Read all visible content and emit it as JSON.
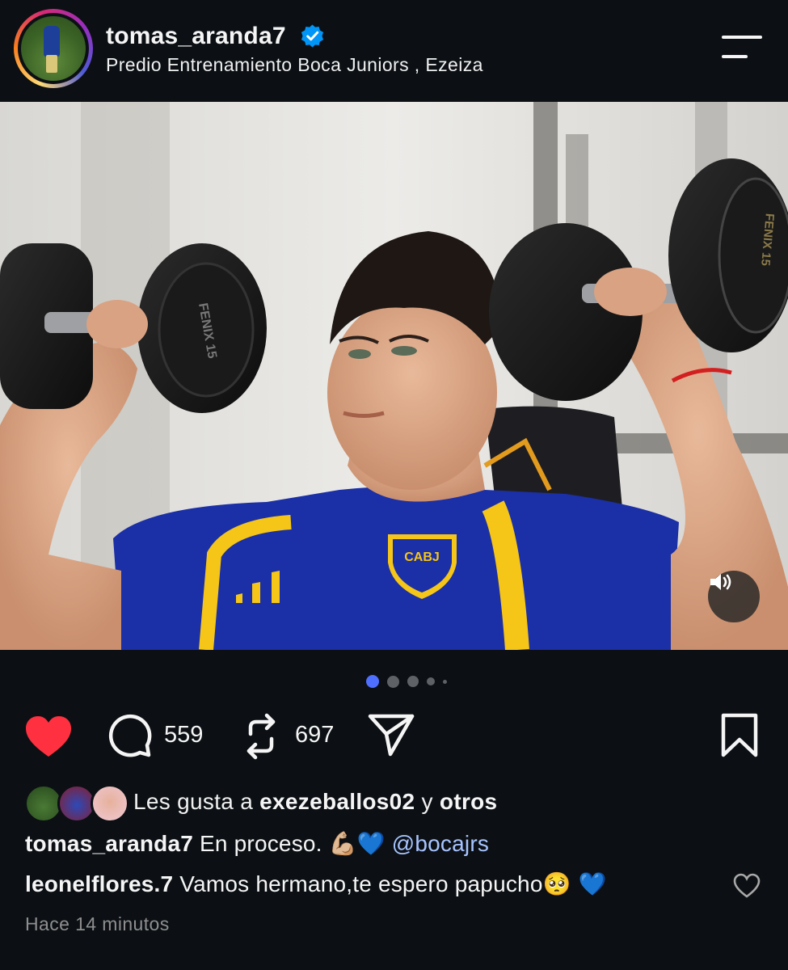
{
  "header": {
    "username": "tomas_aranda7",
    "location": "Predio Entrenamiento Boca Juniors , Ezeiza",
    "verified_icon": "verified-badge-icon",
    "menu_icon": "hamburger-menu-icon"
  },
  "post": {
    "jersey_text": "CABJ",
    "dumbbell_text": "FENIX 15",
    "carousel": {
      "total": 5,
      "active": 1
    }
  },
  "actions": {
    "like_icon": "heart-filled-icon",
    "comment_icon": "comment-icon",
    "comment_count": "559",
    "repost_icon": "repost-icon",
    "repost_count": "697",
    "share_icon": "share-icon",
    "save_icon": "bookmark-icon"
  },
  "likes": {
    "prefix": "Les gusta a",
    "user": "exezeballos02",
    "connector": "y",
    "others": "otros"
  },
  "caption": {
    "username": "tomas_aranda7",
    "text": "En proceso.",
    "emoji": "💪🏼💙",
    "mention": "@bocajrs"
  },
  "comment": {
    "username": "leonelflores.7",
    "text": "Vamos hermano,te espero papucho",
    "emoji": "🥺 💙"
  },
  "timestamp": "Hace 14 minutos",
  "colors": {
    "background": "#0c1014",
    "like": "#ff3040",
    "verified": "#0095f6",
    "mention": "#a7c4ff",
    "active_dot": "#4f6fff",
    "boca_blue": "#1b2fa6",
    "boca_gold": "#f5c518"
  }
}
